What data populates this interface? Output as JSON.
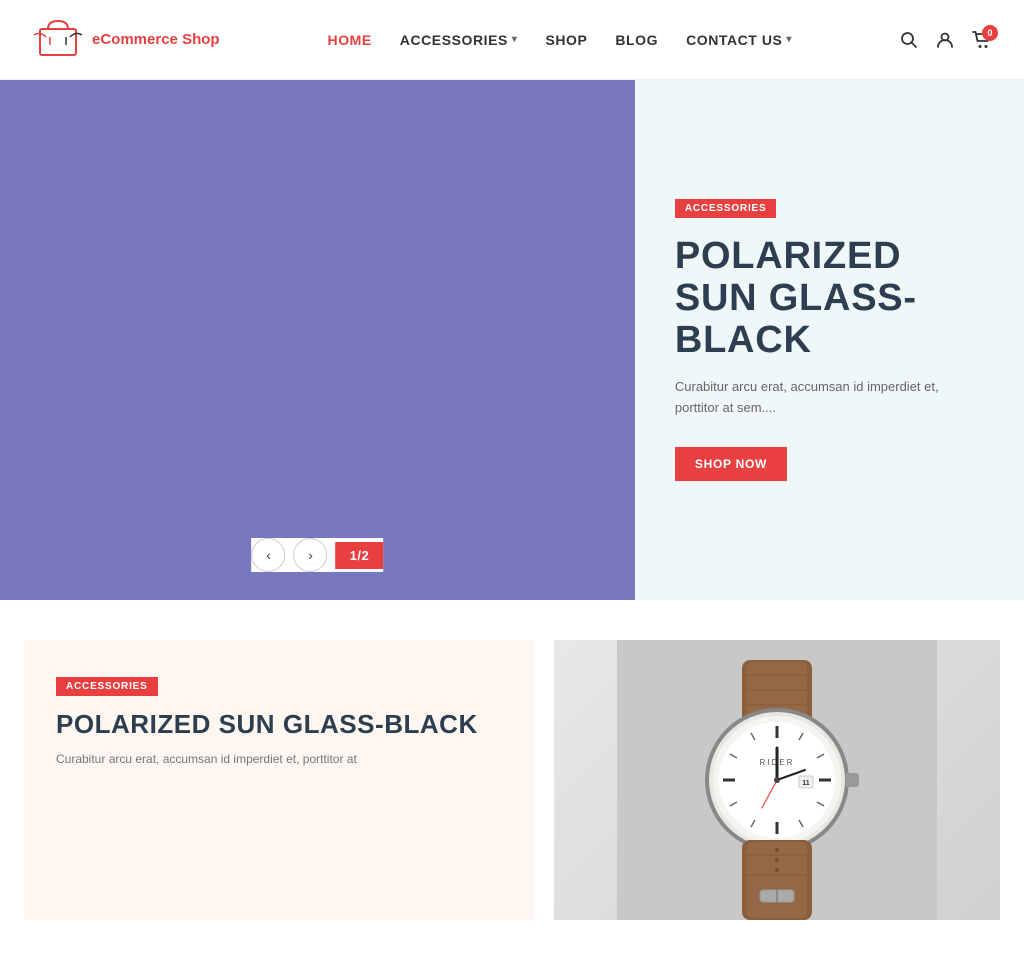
{
  "logo": {
    "text_part1": "eCommerce",
    "text_part2": "Shop"
  },
  "nav": {
    "items": [
      {
        "id": "home",
        "label": "HOME",
        "active": true,
        "hasDropdown": false
      },
      {
        "id": "accessories",
        "label": "ACCESSORIES",
        "active": false,
        "hasDropdown": true
      },
      {
        "id": "shop",
        "label": "SHOP",
        "active": false,
        "hasDropdown": false
      },
      {
        "id": "blog",
        "label": "BLOG",
        "active": false,
        "hasDropdown": false
      },
      {
        "id": "contact-us",
        "label": "CONTACT US",
        "active": false,
        "hasDropdown": true
      }
    ]
  },
  "header_icons": {
    "search_label": "search",
    "account_label": "account",
    "cart_label": "cart",
    "cart_count": "0"
  },
  "hero": {
    "category_badge": "ACCESSORIES",
    "title": "POLARIZED SUN GLASS-BLACK",
    "description": "Curabitur arcu erat, accumsan id imperdiet et, porttitor at sem....",
    "cta_label": "SHOP NOW",
    "slide_current": "1",
    "slide_total": "2"
  },
  "products": {
    "left_card": {
      "category_badge": "ACCESSORIES",
      "title": "POLARIZED SUN GLASS-BLACK",
      "description": "Curabitur arcu erat, accumsan id imperdiet et, porttitor at"
    },
    "right_card": {
      "alt": "Watch product"
    }
  },
  "colors": {
    "accent": "#e84040",
    "dark_text": "#2c3e50",
    "light_bg": "#f0f7f9",
    "hero_bg": "#7878c0"
  }
}
